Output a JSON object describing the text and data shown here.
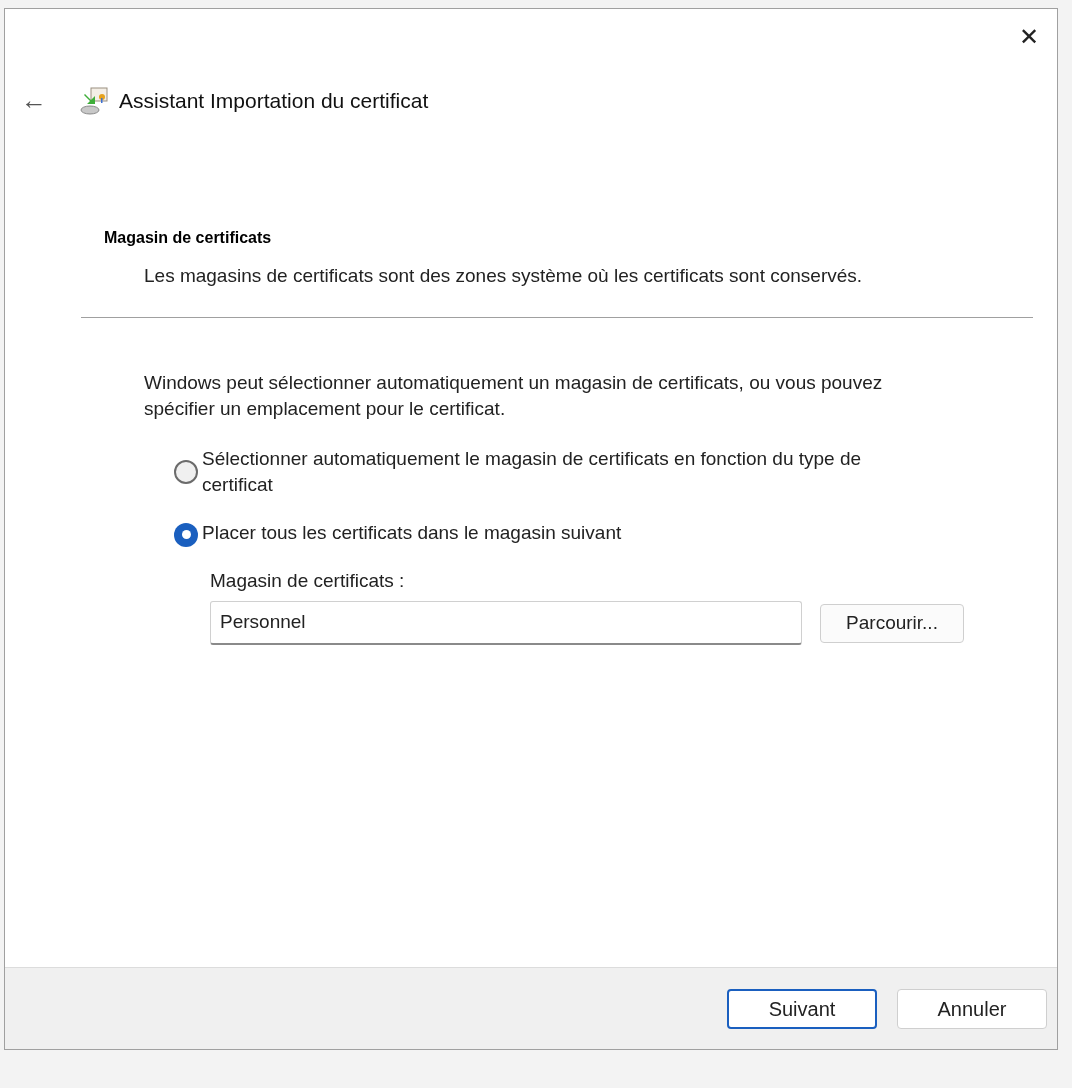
{
  "window": {
    "title": "Assistant Importation du certificat",
    "close": "✕",
    "back": "←"
  },
  "section": {
    "title": "Magasin de certificats",
    "description": "Les magasins de certificats sont des zones système où les certificats sont conservés."
  },
  "intro": "Windows peut sélectionner automatiquement un magasin de certificats, ou vous pouvez spécifier un emplacement pour le certificat.",
  "options": [
    {
      "label": "Sélectionner automatiquement le magasin de certificats en fonction du type de certificat",
      "selected": false
    },
    {
      "label": "Placer tous les certificats dans le magasin suivant",
      "selected": true
    }
  ],
  "store_field": {
    "label": "Magasin de certificats :",
    "value": "Personnel",
    "button": "Parcourir..."
  },
  "buttons": [
    {
      "label": "Suivant",
      "default": true
    },
    {
      "label": "Annuler",
      "default": false
    }
  ]
}
